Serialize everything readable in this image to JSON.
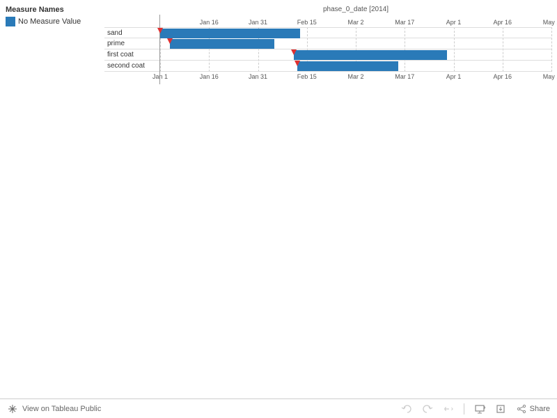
{
  "legend": {
    "title": "Measure Names",
    "item": "No Measure Value",
    "color": "#2a7ab8"
  },
  "axis_title": "phase_0_date [2014]",
  "x_ticks": [
    "Jan 1",
    "Jan 16",
    "Jan 31",
    "Feb 15",
    "Mar 2",
    "Mar 17",
    "Apr 1",
    "Apr 16",
    "May 1"
  ],
  "rows": [
    {
      "label": "sand"
    },
    {
      "label": "prime"
    },
    {
      "label": "first coat"
    },
    {
      "label": "second coat"
    }
  ],
  "toolbar": {
    "view_label": "View on Tableau Public",
    "share_label": "Share"
  },
  "chart_data": {
    "type": "bar",
    "title": "phase_0_date [2014]",
    "xlabel": "phase_0_date [2014]",
    "ylabel": "",
    "x_range": [
      "2014-01-01",
      "2014-05-01"
    ],
    "categories": [
      "sand",
      "prime",
      "first coat",
      "second coat"
    ],
    "series": [
      {
        "name": "No Measure Value",
        "bars": [
          {
            "category": "sand",
            "start": "2014-01-01",
            "end": "2014-02-13"
          },
          {
            "category": "prime",
            "start": "2014-01-04",
            "end": "2014-02-05"
          },
          {
            "category": "first coat",
            "start": "2014-02-11",
            "end": "2014-03-30"
          },
          {
            "category": "second coat",
            "start": "2014-02-12",
            "end": "2014-03-15"
          }
        ]
      }
    ],
    "markers": [
      {
        "category": "sand",
        "date": "2014-01-01"
      },
      {
        "category": "prime",
        "date": "2014-01-04"
      },
      {
        "category": "first coat",
        "date": "2014-02-11"
      },
      {
        "category": "second coat",
        "date": "2014-02-12"
      }
    ],
    "x_ticks": [
      "Jan 1",
      "Jan 16",
      "Jan 31",
      "Feb 15",
      "Mar 2",
      "Mar 17",
      "Apr 1",
      "Apr 16",
      "May 1"
    ]
  }
}
